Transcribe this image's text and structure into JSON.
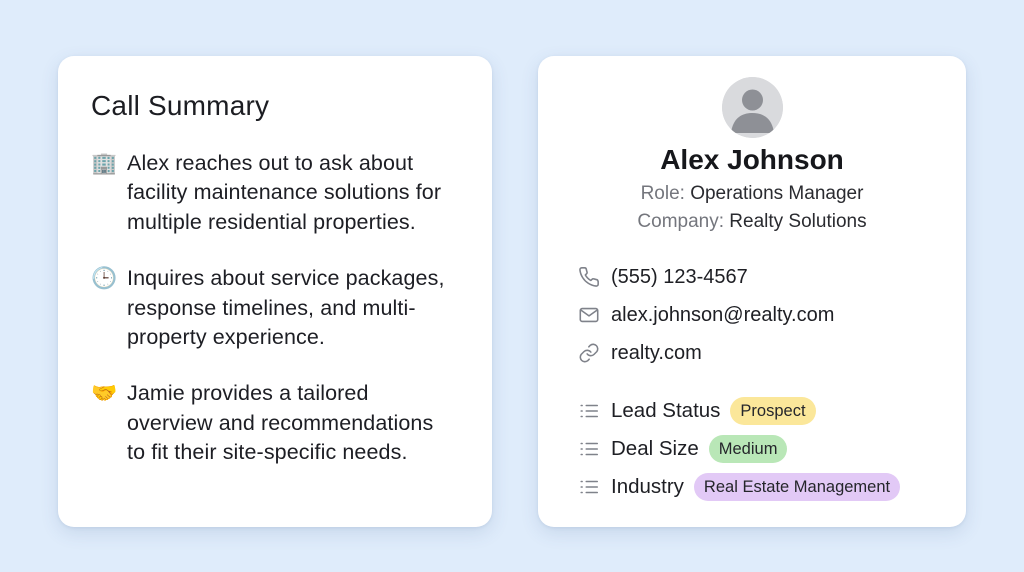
{
  "summary": {
    "title": "Call Summary",
    "items": [
      {
        "icon": "building-icon",
        "emoji": "🏢",
        "text": "Alex reaches out to ask about facility maintenance solutions for multiple residential properties."
      },
      {
        "icon": "clock-icon",
        "emoji": "🕒",
        "text": "Inquires about service packages, response timelines, and multi-property experience."
      },
      {
        "icon": "handshake-icon",
        "emoji": "🤝",
        "text": "Jamie provides a tailored overview and recommendations to fit their site-specific needs."
      }
    ]
  },
  "contact": {
    "avatar_icon": "user-avatar-icon",
    "name": "Alex Johnson",
    "role_label": "Role:",
    "role_value": "Operations Manager",
    "company_label": "Company:",
    "company_value": "Realty Solutions",
    "phone": "(555) 123-4567",
    "email": "alex.johnson@realty.com",
    "website": "realty.com",
    "properties": [
      {
        "label": "Lead Status",
        "value": "Prospect",
        "color": "#fbe79a"
      },
      {
        "label": "Deal Size",
        "value": "Medium",
        "color": "#b9e7b7"
      },
      {
        "label": "Industry",
        "value": "Real Estate Management",
        "color": "#e2c9f6"
      }
    ]
  },
  "colors": {
    "background": "#dfecfb",
    "card": "#ffffff",
    "muted_text": "#74767d",
    "icon_gray": "#7f828a"
  }
}
